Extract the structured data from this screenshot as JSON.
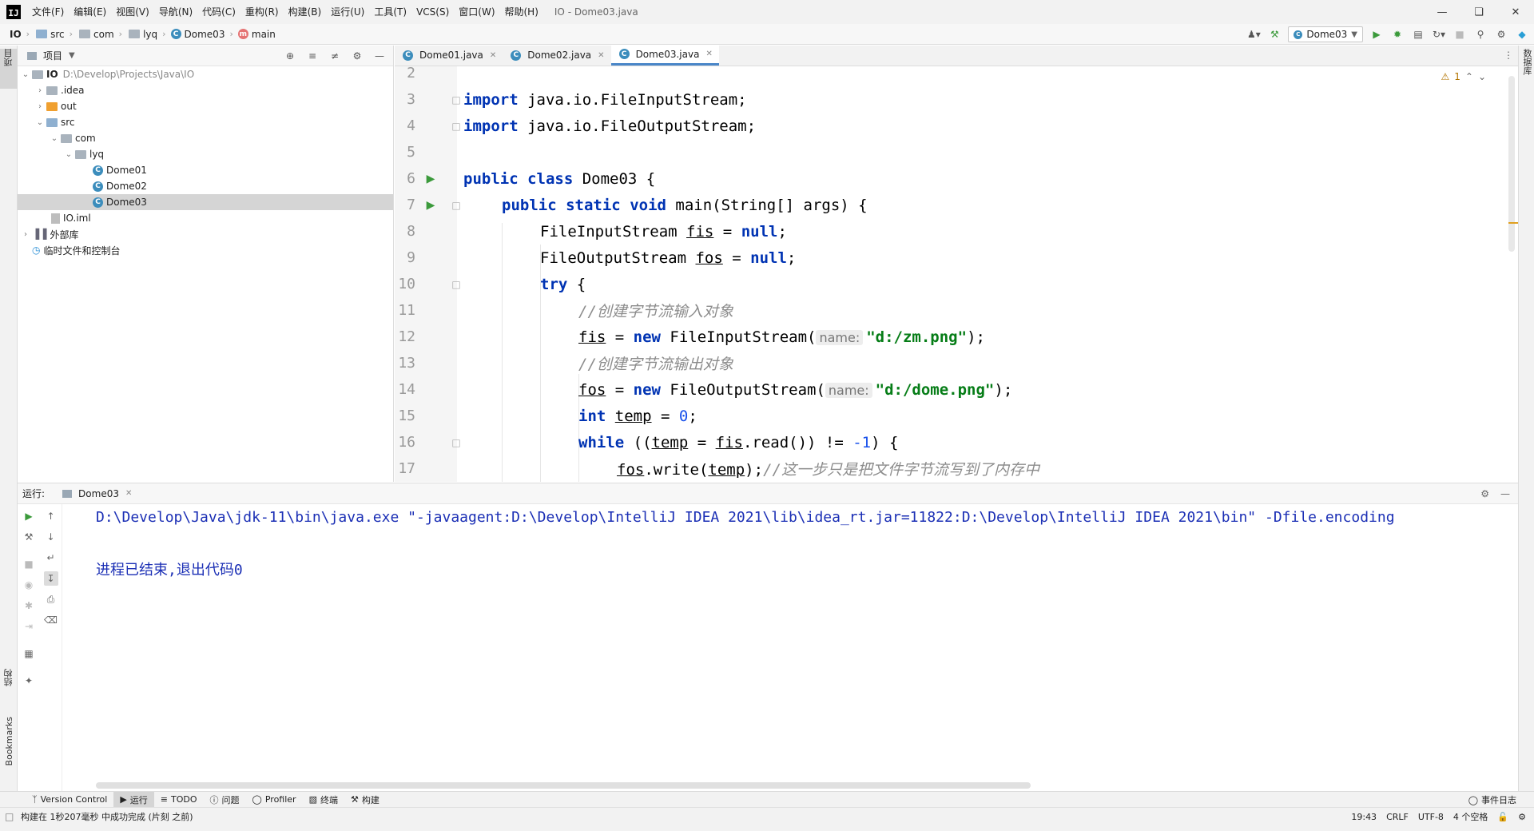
{
  "titlebar": {
    "logo": "IJ",
    "menus": [
      "文件(F)",
      "编辑(E)",
      "视图(V)",
      "导航(N)",
      "代码(C)",
      "重构(R)",
      "构建(B)",
      "运行(U)",
      "工具(T)",
      "VCS(S)",
      "窗口(W)",
      "帮助(H)"
    ],
    "window_title": "IO - Dome03.java"
  },
  "navbar": {
    "crumbs": [
      "IO",
      "src",
      "com",
      "lyq",
      "Dome03",
      "main"
    ],
    "run_config": "Dome03"
  },
  "left_stripe": {
    "project_label": "项目",
    "structure_label": "结构",
    "bookmarks_label": "Bookmarks"
  },
  "right_stripe": {
    "database_label": "数据库"
  },
  "project_panel": {
    "title": "项目",
    "tree": {
      "root": "IO",
      "root_path": "D:\\Develop\\Projects\\Java\\IO",
      "idea": ".idea",
      "out": "out",
      "src": "src",
      "com": "com",
      "lyq": "lyq",
      "dome01": "Dome01",
      "dome02": "Dome02",
      "dome03": "Dome03",
      "iml": "IO.iml",
      "ext_libs": "外部库",
      "scratches": "临时文件和控制台"
    }
  },
  "editor": {
    "tabs": [
      "Dome01.java",
      "Dome02.java",
      "Dome03.java"
    ],
    "active_tab": "Dome03.java",
    "warnings": "1",
    "lines": {
      "l2": "2",
      "l3": "3",
      "l4": "4",
      "l5": "5",
      "l6": "6",
      "l7": "7",
      "l8": "8",
      "l9": "9",
      "l10": "10",
      "l11": "11",
      "l12": "12",
      "l13": "13",
      "l14": "14",
      "l15": "15",
      "l16": "16",
      "l17": "17"
    },
    "code": {
      "import": "import",
      "l3_rest": " java.io.FileInputStream;",
      "l4_rest": " java.io.FileOutputStream;",
      "public": "public",
      "class": "class",
      "l6_rest": " Dome03 {",
      "static": "static",
      "void": "void",
      "l7_rest": " main(String[] args) {",
      "l8_type": "FileInputStream ",
      "fis": "fis",
      "null": "null",
      "l9_type": "FileOutputStream ",
      "fos": "fos",
      "try": "try",
      "brace": " {",
      "comment_in": "//创建字节流输入对象",
      "new": "new",
      "l12_ctor": " FileInputStream(",
      "hint_name": "name:",
      "str_zm": "\"d:/zm.png\"",
      "close_semicolon": ");",
      "comment_out": "//创建字节流输出对象",
      "l14_ctor": " FileOutputStream(",
      "str_dome": "\"d:/dome.png\"",
      "int": "int",
      "temp": "temp",
      "zero": "0",
      "while": "while",
      "l16_a": " ((",
      "l16_b": " = ",
      "l16_c": ".read()) != ",
      "minus_one": "-1",
      "l16_d": ") {",
      "l17_a": ".write(",
      "l17_b": ");",
      "comment_write": "//这一步只是把文件字节流写到了内存中",
      "eq_null": " = ",
      "semicolon": ";",
      "eq": " = "
    }
  },
  "run_panel": {
    "label": "运行:",
    "tab": "Dome03",
    "console": [
      "D:\\Develop\\Java\\jdk-11\\bin\\java.exe \"-javaagent:D:\\Develop\\IntelliJ IDEA 2021\\lib\\idea_rt.jar=11822:D:\\Develop\\IntelliJ IDEA 2021\\bin\" -Dfile.encoding",
      "进程已结束,退出代码0"
    ]
  },
  "tool_windows": {
    "version_control": "Version Control",
    "run": "运行",
    "todo": "TODO",
    "problems": "问题",
    "profiler": "Profiler",
    "terminal": "终端",
    "build": "构建",
    "event_log": "事件日志"
  },
  "statusbar": {
    "message": "构建在 1秒207毫秒 中成功完成 (片刻 之前)",
    "position": "19:43",
    "line_sep": "CRLF",
    "encoding": "UTF-8",
    "indent": "4 个空格"
  }
}
